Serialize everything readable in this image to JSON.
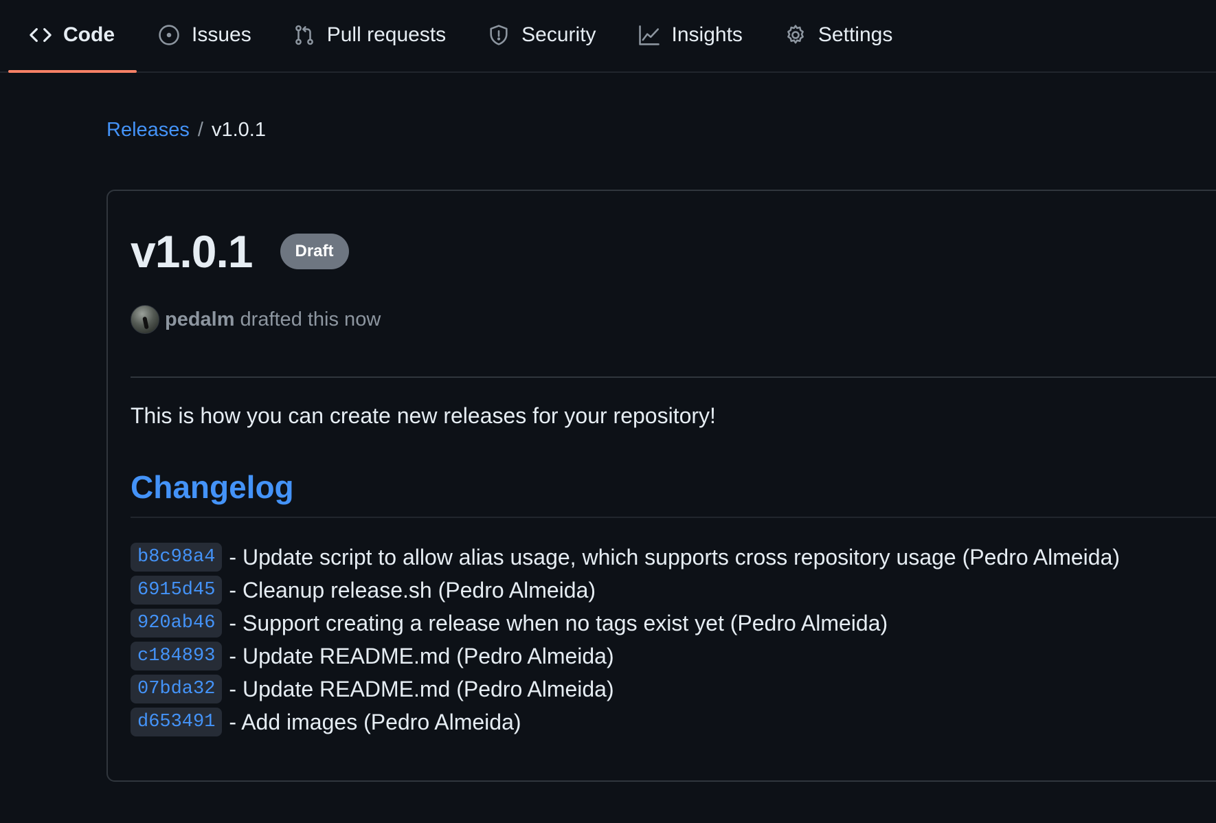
{
  "nav": {
    "tabs": [
      {
        "label": "Code",
        "icon": "code-icon",
        "selected": true
      },
      {
        "label": "Issues",
        "icon": "issue-icon",
        "selected": false
      },
      {
        "label": "Pull requests",
        "icon": "pull-request-icon",
        "selected": false
      },
      {
        "label": "Security",
        "icon": "shield-icon",
        "selected": false
      },
      {
        "label": "Insights",
        "icon": "graph-icon",
        "selected": false
      },
      {
        "label": "Settings",
        "icon": "gear-icon",
        "selected": false
      }
    ],
    "accent_color": "#f78166"
  },
  "breadcrumb": {
    "parent": "Releases",
    "separator": "/",
    "current": "v1.0.1"
  },
  "release": {
    "title": "v1.0.1",
    "badge": "Draft",
    "author": "pedalm",
    "byline_suffix": "drafted this now",
    "intro": "This is how you can create new releases for your repository!",
    "changelog_heading": "Changelog",
    "entries": [
      {
        "sha": "b8c98a4",
        "text": "- Update script to allow alias usage, which supports cross repository usage (Pedro Almeida)"
      },
      {
        "sha": "6915d45",
        "text": "- Cleanup release.sh (Pedro Almeida)"
      },
      {
        "sha": "920ab46",
        "text": "- Support creating a release when no tags exist yet (Pedro Almeida)"
      },
      {
        "sha": "c184893",
        "text": "- Update README.md (Pedro Almeida)"
      },
      {
        "sha": "07bda32",
        "text": "- Update README.md (Pedro Almeida)"
      },
      {
        "sha": "d653491",
        "text": "- Add images (Pedro Almeida)"
      }
    ]
  },
  "colors": {
    "background": "#0d1117",
    "link": "#4493f8",
    "badge": "#6e7681",
    "border": "#30363d"
  }
}
